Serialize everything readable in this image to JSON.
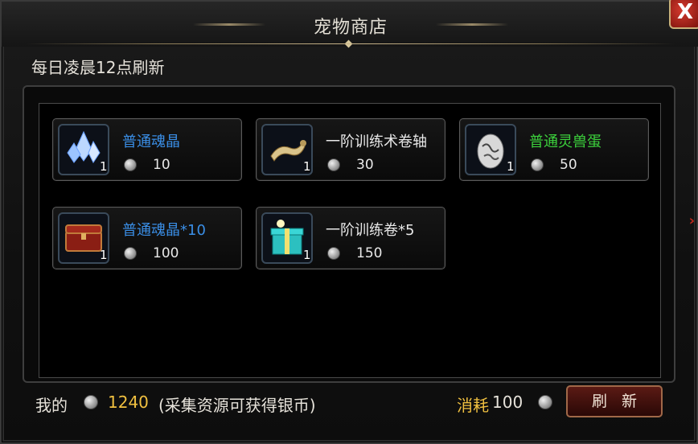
{
  "window": {
    "title": "宠物商店",
    "close_label": "X"
  },
  "notice": "每日凌晨12点刷新",
  "items": [
    {
      "name": "普通魂晶",
      "count": "1",
      "price": "10",
      "name_color": "#3a8ee6",
      "icon": "blue-crystal-icon"
    },
    {
      "name": "一阶训练术卷轴",
      "count": "1",
      "price": "30",
      "name_color": "#e8e8e8",
      "icon": "scroll-icon"
    },
    {
      "name": "普通灵兽蛋",
      "count": "1",
      "price": "50",
      "name_color": "#3cd13c",
      "icon": "egg-icon"
    },
    {
      "name": "普通魂晶*10",
      "count": "1",
      "price": "100",
      "name_color": "#3a8ee6",
      "icon": "treasure-chest-icon"
    },
    {
      "name": "一阶训练卷*5",
      "count": "1",
      "price": "150",
      "name_color": "#e8e8e8",
      "icon": "gift-box-icon"
    }
  ],
  "footer": {
    "my_label": "我的",
    "amount": "1240",
    "hint": "(采集资源可获得银币)",
    "cost_label": "消耗",
    "cost_value": "100",
    "refresh_label": "刷新"
  },
  "colors": {
    "gold": "#f0c040",
    "blue_name": "#3a8ee6",
    "green_name": "#3cd13c"
  }
}
